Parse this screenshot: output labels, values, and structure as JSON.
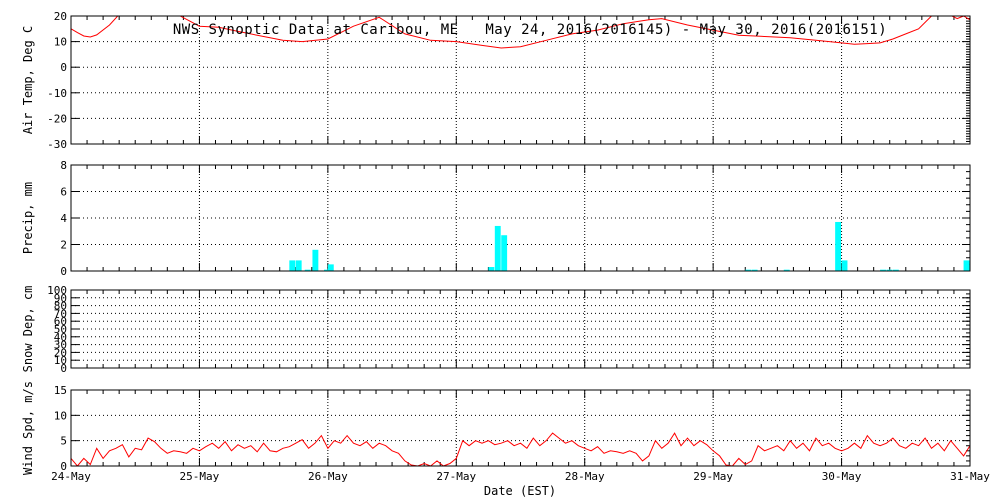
{
  "title": "NWS Synoptic Data at Caribou, ME   May 24, 2016(2016145) - May 30, 2016(2016151)",
  "xlabel": "Date (EST)",
  "x_ticks": [
    "24-May",
    "25-May",
    "26-May",
    "27-May",
    "28-May",
    "29-May",
    "30-May",
    "31-May"
  ],
  "colors": {
    "temp": "#ff0000",
    "precip": "#00ffff",
    "wind": "#ff0000",
    "axes": "#000000",
    "grid": "#000000"
  },
  "chart_data": [
    {
      "type": "line",
      "name": "air_temp",
      "ylabel": "Air Temp, Deg C",
      "ylim": [
        -30,
        20
      ],
      "yticks": [
        -30,
        -20,
        -10,
        0,
        10,
        20
      ],
      "xlim": [
        0,
        7
      ],
      "grid": true,
      "x": [
        0,
        0.05,
        0.1,
        0.15,
        0.2,
        0.3,
        0.4,
        0.5,
        0.8,
        0.85,
        1.0,
        1.15,
        1.3,
        1.5,
        1.65,
        1.8,
        2.0,
        2.2,
        2.4,
        2.6,
        2.8,
        3.0,
        3.2,
        3.35,
        3.5,
        3.7,
        3.9,
        4.1,
        4.3,
        4.5,
        4.6,
        4.8,
        5.0,
        5.2,
        5.4,
        5.6,
        5.8,
        6.0,
        6.1,
        6.2,
        6.3,
        6.4,
        6.5,
        6.6,
        6.7,
        6.75,
        6.8,
        6.9,
        6.95,
        7.0
      ],
      "y": [
        15.0,
        13.5,
        12.2,
        11.8,
        12.6,
        16.5,
        22.0,
        25.0,
        22.0,
        20.0,
        16.0,
        15.6,
        14.0,
        12.0,
        10.5,
        10.0,
        11.0,
        16.0,
        19.5,
        13.0,
        10.5,
        10.0,
        8.5,
        7.5,
        8.0,
        10.5,
        13.0,
        14.5,
        17.0,
        18.5,
        19.0,
        16.5,
        14.5,
        12.5,
        12.0,
        11.5,
        10.5,
        9.5,
        9.0,
        9.2,
        9.5,
        11.0,
        13.0,
        15.0,
        20.0,
        22.5,
        21.5,
        19.0,
        20.0,
        18.5
      ]
    },
    {
      "type": "bar",
      "name": "precip",
      "ylabel": "Precip, mm",
      "ylim": [
        0,
        8
      ],
      "yticks": [
        0,
        2,
        4,
        6,
        8
      ],
      "xlim": [
        0,
        7
      ],
      "grid": true,
      "x": [
        1.7,
        1.75,
        1.82,
        1.88,
        1.97,
        2.0,
        3.25,
        3.3,
        3.35,
        5.25,
        5.3,
        5.55,
        5.95,
        6.0,
        6.3,
        6.35,
        6.4,
        6.95
      ],
      "values": [
        0.8,
        0.8,
        0.1,
        1.6,
        0.1,
        0.5,
        0.3,
        3.4,
        2.7,
        0.1,
        0.1,
        0.1,
        3.7,
        0.8,
        0.1,
        0.1,
        0.1,
        0.8
      ]
    },
    {
      "type": "line",
      "name": "snow_depth",
      "ylabel": "Snow Dep, cm",
      "ylim": [
        0,
        100
      ],
      "yticks": [
        0,
        10,
        20,
        30,
        40,
        50,
        60,
        70,
        80,
        90,
        100
      ],
      "xlim": [
        0,
        7
      ],
      "grid": true,
      "x": [],
      "y": []
    },
    {
      "type": "line",
      "name": "wind_speed",
      "ylabel": "Wind Spd, m/s",
      "ylim": [
        0,
        15
      ],
      "yticks": [
        0,
        5,
        10,
        15
      ],
      "xlim": [
        0,
        7
      ],
      "grid": true,
      "x": [
        0,
        0.05,
        0.1,
        0.15,
        0.2,
        0.25,
        0.3,
        0.35,
        0.4,
        0.45,
        0.5,
        0.55,
        0.6,
        0.65,
        0.7,
        0.75,
        0.8,
        0.85,
        0.9,
        0.95,
        1.0,
        1.05,
        1.1,
        1.15,
        1.2,
        1.25,
        1.3,
        1.35,
        1.4,
        1.45,
        1.5,
        1.55,
        1.6,
        1.65,
        1.7,
        1.75,
        1.8,
        1.85,
        1.9,
        1.95,
        2.0,
        2.05,
        2.1,
        2.15,
        2.2,
        2.25,
        2.3,
        2.35,
        2.4,
        2.45,
        2.5,
        2.55,
        2.6,
        2.65,
        2.7,
        2.75,
        2.8,
        2.85,
        2.9,
        2.95,
        3.0,
        3.05,
        3.1,
        3.15,
        3.2,
        3.25,
        3.3,
        3.35,
        3.4,
        3.45,
        3.5,
        3.55,
        3.6,
        3.65,
        3.7,
        3.75,
        3.8,
        3.85,
        3.9,
        3.95,
        4.0,
        4.05,
        4.1,
        4.15,
        4.2,
        4.25,
        4.3,
        4.35,
        4.4,
        4.45,
        4.5,
        4.55,
        4.6,
        4.65,
        4.7,
        4.75,
        4.8,
        4.85,
        4.9,
        4.95,
        5.0,
        5.05,
        5.1,
        5.15,
        5.2,
        5.25,
        5.3,
        5.35,
        5.4,
        5.45,
        5.5,
        5.55,
        5.6,
        5.65,
        5.7,
        5.75,
        5.8,
        5.85,
        5.9,
        5.95,
        6.0,
        6.05,
        6.1,
        6.15,
        6.2,
        6.25,
        6.3,
        6.35,
        6.4,
        6.45,
        6.5,
        6.55,
        6.6,
        6.65,
        6.7,
        6.75,
        6.8,
        6.85,
        6.9,
        6.95,
        7.0
      ],
      "y": [
        1.5,
        0.0,
        1.5,
        0.3,
        3.5,
        1.5,
        3.0,
        3.5,
        4.2,
        1.8,
        3.5,
        3.2,
        5.5,
        4.8,
        3.5,
        2.5,
        3.0,
        2.8,
        2.5,
        3.5,
        3.0,
        3.8,
        4.5,
        3.5,
        4.8,
        3.0,
        4.2,
        3.5,
        4.0,
        2.8,
        4.5,
        3.0,
        2.8,
        3.5,
        3.8,
        4.5,
        5.2,
        3.5,
        4.5,
        6.0,
        3.5,
        5.0,
        4.5,
        6.0,
        4.5,
        4.0,
        4.8,
        3.5,
        4.5,
        4.0,
        3.0,
        2.5,
        1.0,
        0.2,
        0.0,
        0.5,
        0.0,
        1.0,
        0.0,
        0.5,
        1.5,
        5.0,
        4.0,
        5.0,
        4.5,
        5.0,
        4.2,
        4.5,
        5.0,
        4.0,
        4.5,
        3.5,
        5.5,
        4.0,
        5.0,
        6.5,
        5.5,
        4.5,
        5.0,
        4.0,
        3.5,
        3.0,
        3.8,
        2.5,
        3.0,
        2.8,
        2.5,
        3.0,
        2.5,
        1.0,
        2.0,
        5.0,
        3.5,
        4.5,
        6.5,
        4.0,
        5.5,
        4.0,
        5.0,
        4.2,
        3.0,
        2.0,
        0.2,
        0.0,
        1.5,
        0.3,
        1.0,
        4.0,
        3.0,
        3.5,
        4.0,
        3.0,
        5.0,
        3.5,
        4.5,
        3.0,
        5.5,
        4.0,
        4.5,
        3.5,
        3.0,
        3.5,
        4.5,
        3.5,
        6.0,
        4.5,
        4.0,
        4.5,
        5.5,
        4.0,
        3.5,
        4.5,
        4.0,
        5.5,
        3.5,
        4.5,
        3.0,
        5.0,
        3.5,
        2.0,
        4.0
      ]
    }
  ]
}
